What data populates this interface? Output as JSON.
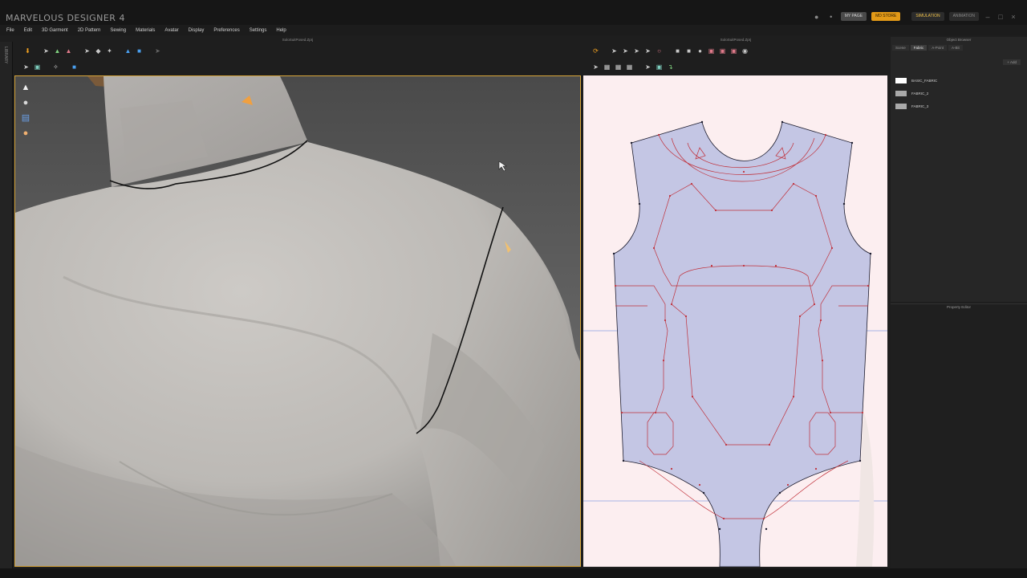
{
  "app": {
    "title": "MARVELOUS DESIGNER 4",
    "top_buttons": {
      "my_page": "MY PAGE",
      "md_store": "MD STORE",
      "simulation": "SIMULATION",
      "animation": "ANIMATION"
    }
  },
  "menu": [
    "File",
    "Edit",
    "3D Garment",
    "2D Pattern",
    "Sewing",
    "Materials",
    "Avatar",
    "Display",
    "Preferences",
    "Settings",
    "Help"
  ],
  "sidebar": {
    "library_label": "LIBRARY"
  },
  "panels": {
    "view3d_title": "SoloSuitPosed.Zprj",
    "view2d_title": "SoloSuitPosed.Zprj"
  },
  "object_browser": {
    "title": "Object Browser",
    "tabs": [
      "Scene",
      "Fabric",
      "A-Point",
      "A-Bit"
    ],
    "active_tab": "Fabric",
    "add_label": "+ Add",
    "fabrics": [
      {
        "name": "BASIC_FABRIC",
        "color": "#ffffff"
      },
      {
        "name": "FABRIC_2",
        "color": "#a9a9a9"
      },
      {
        "name": "FABRIC_3",
        "color": "#a9a9a9"
      }
    ]
  },
  "property_editor": {
    "title": "Property Editor"
  },
  "colors": {
    "accent": "#e39a17",
    "viewport_border": "#d7a53a",
    "pattern_fill": "#c4c6e4",
    "seam_line": "#c0303a",
    "pattern_bg": "#fceef0"
  }
}
